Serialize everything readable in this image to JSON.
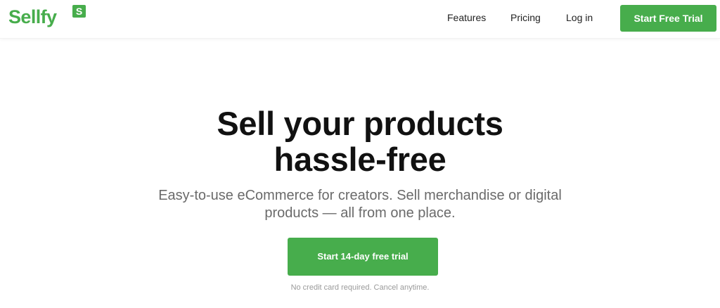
{
  "header": {
    "logo": {
      "word": "Sellfy",
      "badge": "S"
    },
    "nav": {
      "features": "Features",
      "pricing": "Pricing",
      "login": "Log in"
    },
    "cta_label": "Start Free Trial"
  },
  "hero": {
    "title_line1": "Sell your products",
    "title_line2": "hassle-free",
    "subtitle_line1": "Easy-to-use eCommerce for creators. Sell merchandise or digital",
    "subtitle_line2": "products — all from one place.",
    "cta_label": "Start 14-day free trial",
    "note": "No credit card required. Cancel anytime."
  },
  "colors": {
    "brand_green": "#47ad4c",
    "text_dark": "#111111",
    "text_muted": "#6a6a6a",
    "note_gray": "#9a9a9a"
  }
}
